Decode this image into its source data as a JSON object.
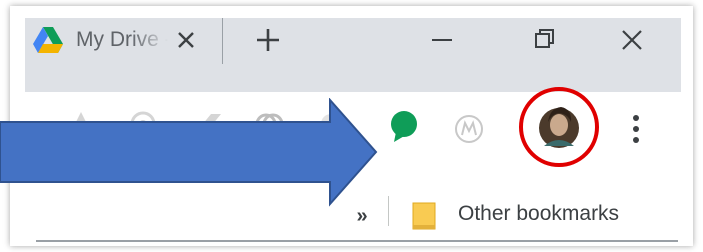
{
  "tab": {
    "title": "My Drive - Google Drive",
    "favicon": "google-drive-icon"
  },
  "window_controls": [
    "minimize-icon",
    "restore-icon",
    "close-icon"
  ],
  "toolbar": {
    "extensions": [
      "extension-icon",
      "extension-icon",
      "extension-icon",
      "extension-icon",
      "extension-icon",
      "green-speech-bubble-icon",
      "m-circle-icon"
    ],
    "profile": "avatar",
    "menu": "three-dots-icon"
  },
  "bookmarks": {
    "overflow_label": "»",
    "other_label": "Other bookmarks"
  },
  "colors": {
    "titlebar_bg": "#dee1e6",
    "arrow_fill": "#4472c4",
    "highlight_circle": "#e00000",
    "extension_green": "#0f9d58",
    "folder_yellow": "#f9cb52"
  }
}
